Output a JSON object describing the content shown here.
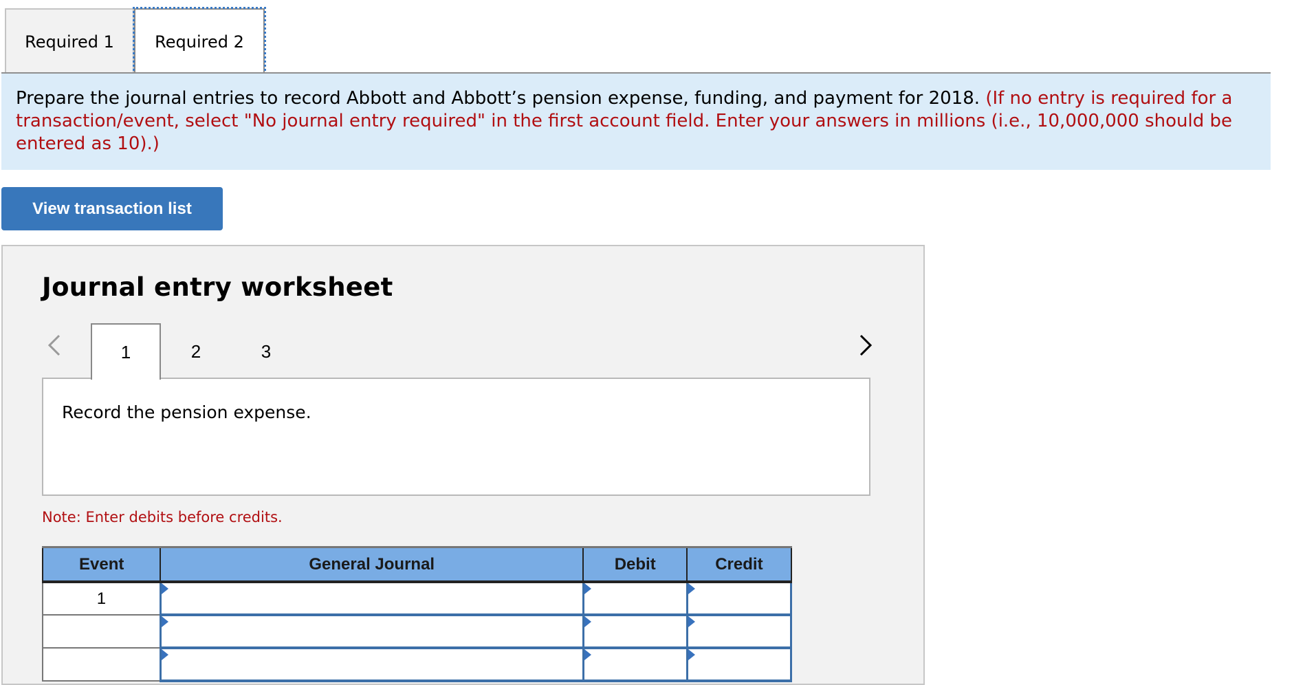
{
  "tabs": [
    {
      "label": "Required 1",
      "active": false
    },
    {
      "label": "Required 2",
      "active": true
    }
  ],
  "instructions": {
    "main": "Prepare the journal entries to record Abbott and Abbott’s pension expense, funding, and payment for 2018.",
    "note": "(If no entry is required for a transaction/event, select \"No journal entry required\" in the first account field. Enter your answers in millions (i.e., 10,000,000 should be entered as 10).)"
  },
  "view_transaction_button": "View transaction list",
  "worksheet": {
    "title": "Journal entry worksheet",
    "prev_icon": "chevron-left-icon",
    "next_icon": "chevron-right-icon",
    "pages": [
      "1",
      "2",
      "3"
    ],
    "active_page": "1",
    "description": "Record the pension expense.",
    "note": "Note: Enter debits before credits.",
    "table": {
      "headers": [
        "Event",
        "General Journal",
        "Debit",
        "Credit"
      ],
      "rows": [
        {
          "event": "1",
          "account": "",
          "debit": "",
          "credit": ""
        },
        {
          "event": "",
          "account": "",
          "debit": "",
          "credit": ""
        },
        {
          "event": "",
          "account": "",
          "debit": "",
          "credit": ""
        }
      ]
    }
  },
  "colors": {
    "instruction_bg": "#dbecf9",
    "instruction_red": "#b10f12",
    "button_blue": "#3877bb",
    "table_header": "#79ace4",
    "input_border": "#3c6fa8"
  }
}
